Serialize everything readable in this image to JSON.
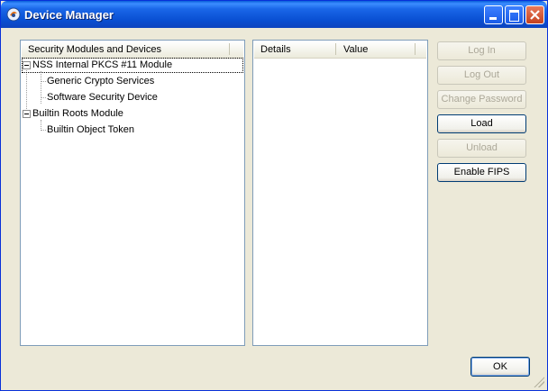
{
  "window": {
    "title": "Device Manager"
  },
  "tree": {
    "header": "Security Modules and Devices",
    "items": [
      {
        "label": "NSS Internal PKCS #11 Module",
        "level": 0,
        "expanded": true,
        "selected": true
      },
      {
        "label": "Generic Crypto Services",
        "level": 1
      },
      {
        "label": "Software Security Device",
        "level": 1
      },
      {
        "label": "Builtin Roots Module",
        "level": 0,
        "expanded": true
      },
      {
        "label": "Builtin Object Token",
        "level": 1
      }
    ]
  },
  "details": {
    "col_details": "Details",
    "col_value": "Value"
  },
  "buttons": {
    "log_in": "Log In",
    "log_out": "Log Out",
    "change_password": "Change Password",
    "load": "Load",
    "unload": "Unload",
    "enable_fips": "Enable FIPS",
    "ok": "OK"
  },
  "colors": {
    "titlebar": "#0a50d3",
    "dialog_bg": "#ece9d8",
    "panel_border": "#7f9db9"
  },
  "icons": [
    "app-icon",
    "minimize-icon",
    "maximize-icon",
    "close-icon",
    "collapse-icon"
  ]
}
